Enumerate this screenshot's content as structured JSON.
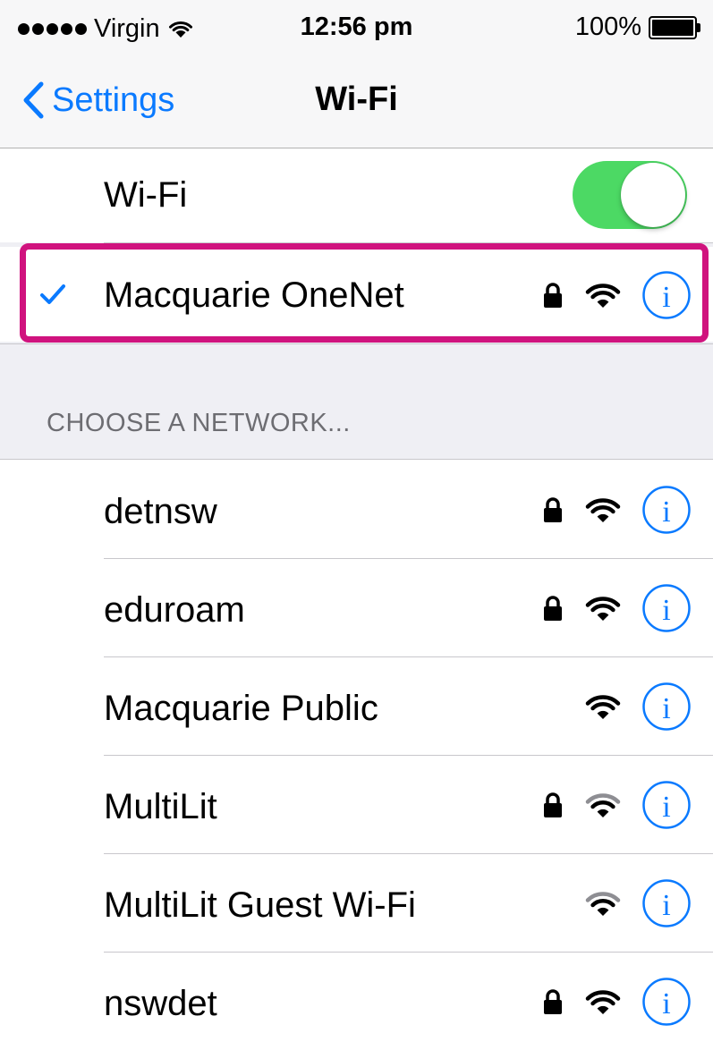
{
  "status_bar": {
    "carrier": "Virgin",
    "time": "12:56 pm",
    "battery": "100%",
    "battery_level": 1.0,
    "signal_bars_total": 5,
    "signal_bars_filled": 5
  },
  "nav": {
    "back_label": "Settings",
    "title": "Wi-Fi"
  },
  "wifi_toggle": {
    "label": "Wi-Fi",
    "on": true
  },
  "connected_network": {
    "name": "Macquarie OneNet",
    "secured": true,
    "signal": "strong",
    "highlighted": true,
    "highlight_color": "#d0137e"
  },
  "section_header": "CHOOSE A NETWORK...",
  "networks": [
    {
      "name": "detnsw",
      "secured": true,
      "signal": "strong"
    },
    {
      "name": "eduroam",
      "secured": true,
      "signal": "strong"
    },
    {
      "name": "Macquarie Public",
      "secured": false,
      "signal": "strong"
    },
    {
      "name": "MultiLit",
      "secured": true,
      "signal": "medium"
    },
    {
      "name": "MultiLit Guest Wi-Fi",
      "secured": false,
      "signal": "medium"
    },
    {
      "name": "nswdet",
      "secured": true,
      "signal": "strong"
    }
  ],
  "colors": {
    "accent": "#0a7aff",
    "toggle_on": "#4cd964",
    "background": "#efeff4"
  }
}
